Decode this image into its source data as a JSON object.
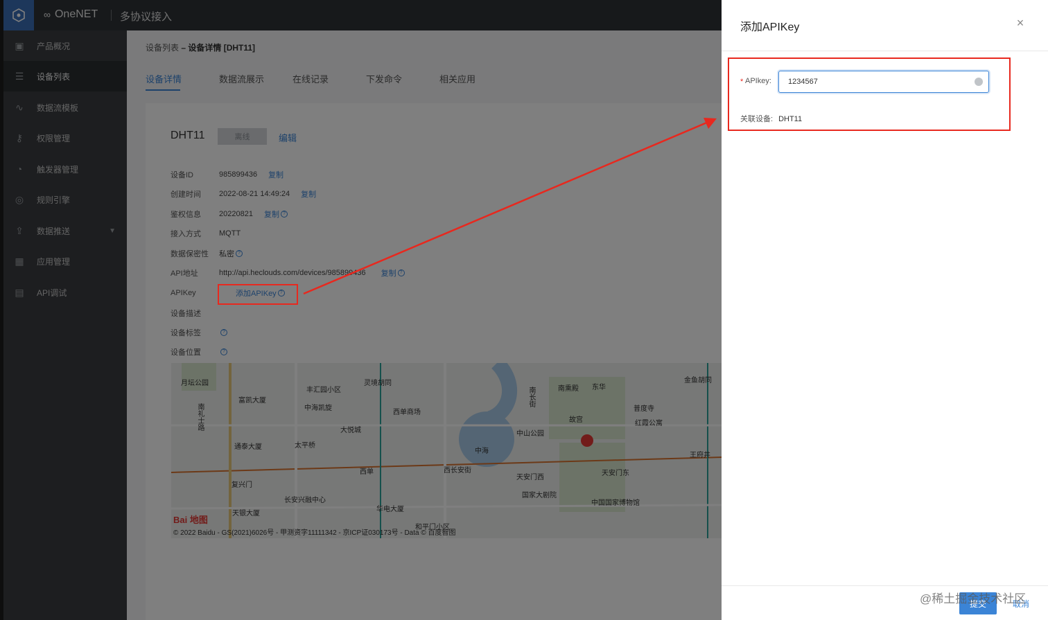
{
  "topbar": {
    "brand": "OneNET",
    "title": "多协议接入"
  },
  "sidebar": {
    "items": [
      {
        "label": "产品概况",
        "icon": "cube-icon"
      },
      {
        "label": "设备列表",
        "icon": "list-icon"
      },
      {
        "label": "数据流模板",
        "icon": "stream-icon"
      },
      {
        "label": "权限管理",
        "icon": "key-icon"
      },
      {
        "label": "触发器管理",
        "icon": "trigger-icon"
      },
      {
        "label": "规则引擎",
        "icon": "rule-icon"
      },
      {
        "label": "数据推送",
        "icon": "push-icon"
      },
      {
        "label": "应用管理",
        "icon": "grid-icon"
      },
      {
        "label": "API调试",
        "icon": "api-icon"
      }
    ]
  },
  "breadcrumb": {
    "parent": "设备列表",
    "sep": " – ",
    "current": "设备详情 [DHT11]"
  },
  "tabs": [
    "设备详情",
    "数据流展示",
    "在线记录",
    "下发命令",
    "相关应用"
  ],
  "device": {
    "name": "DHT11",
    "status_button": "离线",
    "edit_link": "编辑",
    "copy_label": "复制",
    "fields": {
      "id_label": "设备ID",
      "id_value": "985899436",
      "created_label": "创建时间",
      "created_value": "2022-08-21 14:49:24",
      "auth_label": "鉴权信息",
      "auth_value": "20220821",
      "access_label": "接入方式",
      "access_value": "MQTT",
      "privacy_label": "数据保密性",
      "privacy_value": "私密",
      "api_label": "API地址",
      "api_value": "http://api.heclouds.com/devices/985899436",
      "apikey_label": "APIKey",
      "apikey_link": "添加APIKey",
      "desc_label": "设备描述",
      "tags_label": "设备标签",
      "loc_label": "设备位置"
    }
  },
  "map": {
    "logo": "Bai 地图",
    "copyright": "© 2022 Baidu - GS(2021)6026号 - 甲测资字11111342 - 京ICP证030173号 - Data © 百度智图",
    "labels": [
      "月坛公园",
      "丰汇园小区",
      "灵境胡同",
      "富凯大厦",
      "中海凯旋",
      "西单商场",
      "大悦城",
      "通泰大厦",
      "太平桥",
      "西单",
      "西长安街",
      "复兴门",
      "长安兴融中心",
      "华电大厦",
      "天银大厦",
      "和平门小区",
      "中海",
      "南长街",
      "南熏殿",
      "东华",
      "故宫",
      "中山公园",
      "天安门西",
      "国家大剧院",
      "天安门东",
      "中国国家博物馆",
      "普度寺",
      "红霞公寓",
      "王府井",
      "金鱼胡同",
      "南礼士路"
    ]
  },
  "drawer": {
    "title": "添加APIKey",
    "close": "×",
    "apikey_label": "APIkey:",
    "apikey_value": "1234567",
    "device_label": "关联设备:",
    "device_value": "DHT11",
    "submit": "提交",
    "cancel": "取消"
  },
  "watermark": "@稀土掘金技术社区",
  "colors": {
    "accent": "#3b84d6",
    "annotation": "#e8281e",
    "sidebar": "#3a3d41",
    "topbar": "#2f3337"
  }
}
